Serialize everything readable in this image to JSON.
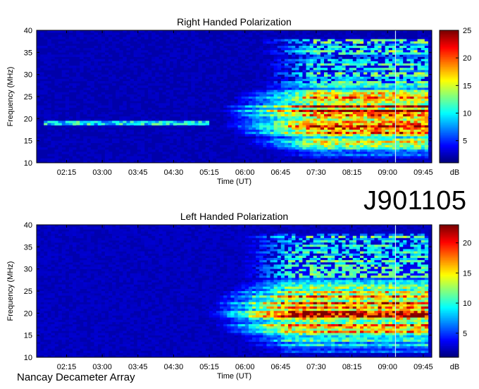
{
  "page": {
    "identifier": "J901105",
    "footer": "Nancay Decameter Array"
  },
  "colors": {
    "colormap": [
      "#00007f",
      "#0000ff",
      "#0080ff",
      "#00ffff",
      "#80ff80",
      "#ffff00",
      "#ff8000",
      "#ff0000",
      "#7f0000"
    ],
    "frame": "#000000",
    "marker_line": "#c8e8ff"
  },
  "chart_data": [
    {
      "type": "heatmap",
      "title": "Right Handed Polarization",
      "xlabel": "Time (UT)",
      "ylabel": "Frequency (MHz)",
      "x_ticks": [
        "02:15",
        "03:00",
        "03:45",
        "04:30",
        "05:15",
        "06:00",
        "06:45",
        "07:30",
        "08:15",
        "09:00",
        "09:45"
      ],
      "y_ticks": [
        10,
        15,
        20,
        25,
        30,
        35,
        40
      ],
      "ylim": [
        10,
        40
      ],
      "colorbar": {
        "label": "dB",
        "ticks": [
          5,
          10,
          15,
          20,
          25
        ],
        "range": [
          1,
          25
        ]
      },
      "marker_time": "09:10",
      "features": {
        "background_db": 2,
        "early_band": {
          "freq_mhz": 19,
          "db": 12,
          "start": "01:45",
          "end": "05:15"
        },
        "emission": {
          "start": "05:15",
          "peak_start": "07:30",
          "end": "09:50",
          "freq_low_mhz": 11,
          "freq_high_mhz": 38,
          "core_db": 24
        }
      }
    },
    {
      "type": "heatmap",
      "title": "Left Handed Polarization",
      "xlabel": "Time (UT)",
      "ylabel": "Frequency (MHz)",
      "x_ticks": [
        "02:15",
        "03:00",
        "03:45",
        "04:30",
        "05:15",
        "06:00",
        "06:45",
        "07:30",
        "08:15",
        "09:00",
        "09:45"
      ],
      "y_ticks": [
        10,
        15,
        20,
        25,
        30,
        35,
        40
      ],
      "ylim": [
        10,
        40
      ],
      "colorbar": {
        "label": "dB",
        "ticks": [
          5,
          10,
          15,
          20
        ],
        "range": [
          1,
          23
        ]
      },
      "marker_time": "09:10",
      "features": {
        "background_db": 2,
        "emission": {
          "start": "05:00",
          "peak_start": "07:00",
          "end": "09:50",
          "freq_low_mhz": 11,
          "freq_high_mhz": 38,
          "core_db": 22
        }
      }
    }
  ]
}
